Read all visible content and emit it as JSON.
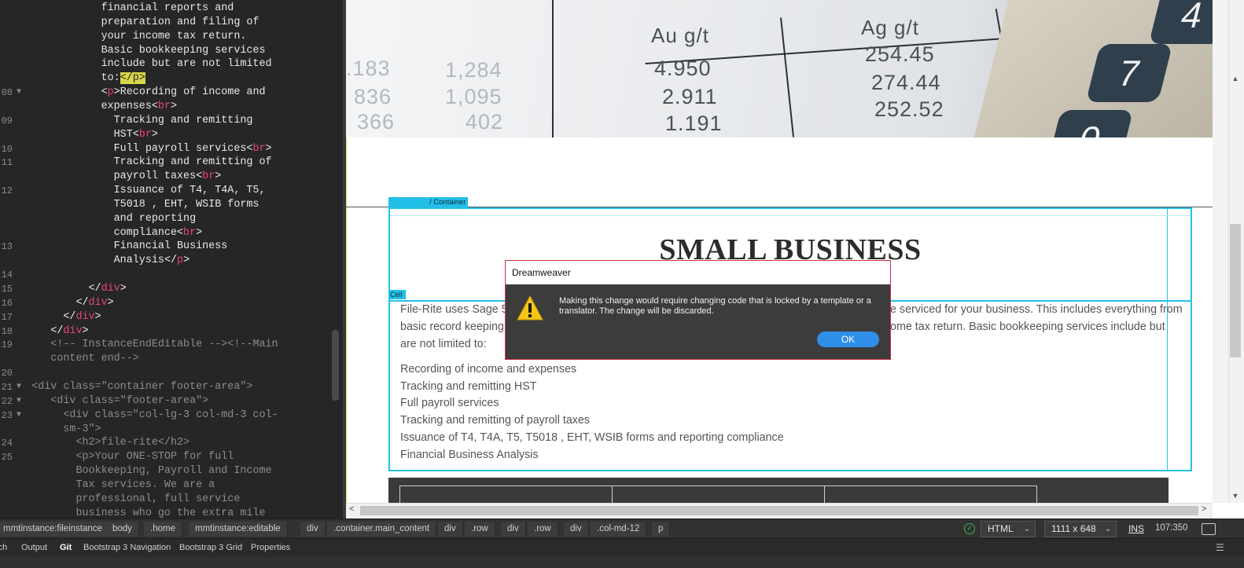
{
  "code": {
    "lines": [
      {
        "num": "",
        "fold": false,
        "html": "                financial reports and"
      },
      {
        "num": "",
        "fold": false,
        "html": "                preparation and filing of"
      },
      {
        "num": "",
        "fold": false,
        "html": "                your income tax return."
      },
      {
        "num": "",
        "fold": false,
        "html": "                Basic bookkeeping services"
      },
      {
        "num": "",
        "fold": false,
        "html": "                include but are not limited"
      },
      {
        "num": "",
        "fold": false,
        "html": "                to:<span class=\"hl\">&lt;/p&gt;</span>"
      },
      {
        "num": "08",
        "fold": true,
        "html": "                <span class=\"tag\">&lt;</span><span class=\"tname\">p</span><span class=\"tag\">&gt;</span>Recording of income and"
      },
      {
        "num": "",
        "fold": false,
        "html": "                expenses<span class=\"tag\">&lt;</span><span class=\"tname\">br</span><span class=\"tag\">&gt;</span>"
      },
      {
        "num": "09",
        "fold": false,
        "html": "                  Tracking and remitting"
      },
      {
        "num": "",
        "fold": false,
        "html": "                  HST<span class=\"tag\">&lt;</span><span class=\"tname\">br</span><span class=\"tag\">&gt;</span>"
      },
      {
        "num": "10",
        "fold": false,
        "html": "                  Full payroll services<span class=\"tag\">&lt;</span><span class=\"tname\">br</span><span class=\"tag\">&gt;</span>"
      },
      {
        "num": "11",
        "fold": false,
        "html": "                  Tracking and remitting of"
      },
      {
        "num": "",
        "fold": false,
        "html": "                  payroll taxes<span class=\"tag\">&lt;</span><span class=\"tname\">br</span><span class=\"tag\">&gt;</span>"
      },
      {
        "num": "12",
        "fold": false,
        "html": "                  Issuance of T4, T4A, T5,"
      },
      {
        "num": "",
        "fold": false,
        "html": "                  T5018 , EHT, WSIB forms"
      },
      {
        "num": "",
        "fold": false,
        "html": "                  and reporting"
      },
      {
        "num": "",
        "fold": false,
        "html": "                  compliance<span class=\"tag\">&lt;</span><span class=\"tname\">br</span><span class=\"tag\">&gt;</span>"
      },
      {
        "num": "13",
        "fold": false,
        "html": "                  Financial Business"
      },
      {
        "num": "",
        "fold": false,
        "html": "                  Analysis<span class=\"tag\">&lt;/</span><span class=\"tname\">p</span><span class=\"tag\">&gt;</span>"
      },
      {
        "num": "14",
        "fold": false,
        "html": ""
      },
      {
        "num": "15",
        "fold": false,
        "html": "              <span class=\"tag\">&lt;/</span><span class=\"tname\">div</span><span class=\"tag\">&gt;</span>"
      },
      {
        "num": "16",
        "fold": false,
        "html": "            <span class=\"tag\">&lt;/</span><span class=\"tname\">div</span><span class=\"tag\">&gt;</span>"
      },
      {
        "num": "17",
        "fold": false,
        "html": "          <span class=\"tag\">&lt;/</span><span class=\"tname\">div</span><span class=\"tag\">&gt;</span>"
      },
      {
        "num": "18",
        "fold": false,
        "html": "        <span class=\"tag\">&lt;/</span><span class=\"tname\">div</span><span class=\"tag\">&gt;</span>"
      },
      {
        "num": "19",
        "fold": false,
        "html": "        <span class=\"com\">&lt;!-- InstanceEndEditable --&gt;&lt;!--Main</span>"
      },
      {
        "num": "",
        "fold": false,
        "html": "        <span class=\"com\">content end--&gt;</span>"
      },
      {
        "num": "20",
        "fold": false,
        "html": ""
      },
      {
        "num": "21",
        "fold": true,
        "html": "     <span class=\"com\">&lt;div class=\"container footer-area\"&gt;</span>"
      },
      {
        "num": "22",
        "fold": true,
        "html": "        <span class=\"com\">&lt;div class=\"footer-area\"&gt;</span>"
      },
      {
        "num": "23",
        "fold": true,
        "html": "          <span class=\"com\">&lt;div class=\"col-lg-3 col-md-3 col-</span>"
      },
      {
        "num": "",
        "fold": false,
        "html": "          <span class=\"com\">sm-3\"&gt;</span>"
      },
      {
        "num": "24",
        "fold": false,
        "html": "            <span class=\"com\">&lt;h2&gt;file-rite&lt;/h2&gt;</span>"
      },
      {
        "num": "25",
        "fold": false,
        "html": "            <span class=\"com\">&lt;p&gt;Your ONE-STOP for full</span>"
      },
      {
        "num": "",
        "fold": false,
        "html": "            <span class=\"com\">Bookkeeping, Payroll and Income</span>"
      },
      {
        "num": "",
        "fold": false,
        "html": "            <span class=\"com\">Tax services. We are a</span>"
      },
      {
        "num": "",
        "fold": false,
        "html": "            <span class=\"com\">professional, full service</span>"
      },
      {
        "num": "",
        "fold": false,
        "html": "            <span class=\"com\">business who go the extra mile</span>"
      }
    ]
  },
  "design": {
    "hero": {
      "col_au": "Au g/t",
      "col_ag": "Ag g/t",
      "left_values": [
        ".183",
        "836",
        "366"
      ],
      "mid_values": [
        "1,284",
        "1,095",
        "402"
      ],
      "au_values": [
        "4.950",
        "2.911",
        "1.191"
      ],
      "ag_values": [
        "254.45",
        "274.44",
        "252.52"
      ],
      "keys": [
        "4",
        "7",
        "0"
      ]
    },
    "container_tab": "/ Container",
    "cell_tab": "Cell",
    "heading": "SMALL BUSINESS",
    "paragraph_line1_left": "File-Rite uses Sage 5",
    "paragraph_line1_right": "e serviced for your business. This includes everything from",
    "paragraph_line2_left": "basic record keeping",
    "paragraph_line2_right": "ome tax return. Basic bookkeeping services include but",
    "paragraph_line3": "are not limited to:",
    "services": [
      "Recording of income and expenses",
      "Tracking and remitting HST",
      "Full payroll services",
      "Tracking and remitting of payroll taxes",
      "Issuance of T4, T4A, T5, T5018 , EHT, WSIB forms and reporting compliance",
      "Financial Business Analysis"
    ]
  },
  "dialog": {
    "title": "Dreamweaver",
    "message": "Making this change would require changing code that is locked by a template or a translator.  The change will be discarded.",
    "ok_label": "OK"
  },
  "status": {
    "breadcrumbs": [
      "mmtinstance:fileinstance",
      "body",
      ".home",
      "mmtinstance:editable",
      "div",
      ".container.main_content",
      "div",
      ".row",
      "div",
      ".row",
      "div",
      ".col-md-12",
      "p"
    ],
    "doc_type": "HTML",
    "window_size": "1111 x 648",
    "ins": "INS",
    "cursor": "107:350"
  },
  "panels": {
    "tabs": [
      "rch",
      "Output",
      "Git",
      "Bootstrap 3 Navigation",
      "Bootstrap 3 Grid",
      "Properties"
    ],
    "active": "Git"
  },
  "colors": {
    "selection_outline": "#26c1e6",
    "dialog_border": "#cc3340",
    "ok_button": "#2f8ee8",
    "tag_name": "#e8457b",
    "highlight": "#d7d74a"
  }
}
